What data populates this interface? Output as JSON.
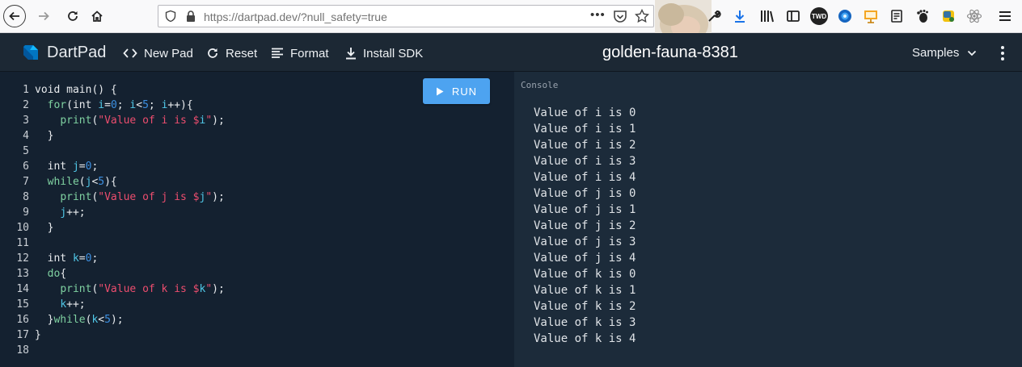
{
  "browser": {
    "url_host": "https://dartpad.dev/",
    "url_path": "?null_safety=true",
    "more_label": "•••",
    "ext_twd_label": "TWD"
  },
  "header": {
    "brand": "DartPad",
    "new_pad": "New Pad",
    "reset": "Reset",
    "format": "Format",
    "install_sdk": "Install SDK",
    "pad_title": "golden-fauna-8381",
    "samples": "Samples"
  },
  "editor": {
    "run_label": "RUN",
    "lines": [
      {
        "n": "1",
        "tokens": [
          {
            "t": "void main() {",
            "c": "plain"
          }
        ]
      },
      {
        "n": "2",
        "tokens": [
          {
            "t": "  ",
            "c": "plain"
          },
          {
            "t": "for",
            "c": "kw"
          },
          {
            "t": "(int ",
            "c": "plain"
          },
          {
            "t": "i",
            "c": "var"
          },
          {
            "t": "=",
            "c": "plain"
          },
          {
            "t": "0",
            "c": "num"
          },
          {
            "t": "; ",
            "c": "plain"
          },
          {
            "t": "i",
            "c": "var"
          },
          {
            "t": "<",
            "c": "plain"
          },
          {
            "t": "5",
            "c": "num"
          },
          {
            "t": "; ",
            "c": "plain"
          },
          {
            "t": "i",
            "c": "var"
          },
          {
            "t": "++){",
            "c": "plain"
          }
        ]
      },
      {
        "n": "3",
        "tokens": [
          {
            "t": "    ",
            "c": "plain"
          },
          {
            "t": "print",
            "c": "fn"
          },
          {
            "t": "(",
            "c": "plain"
          },
          {
            "t": "\"Value of i is $",
            "c": "str"
          },
          {
            "t": "i",
            "c": "var"
          },
          {
            "t": "\"",
            "c": "str"
          },
          {
            "t": ");",
            "c": "plain"
          }
        ]
      },
      {
        "n": "4",
        "tokens": [
          {
            "t": "  }",
            "c": "plain"
          }
        ]
      },
      {
        "n": "5",
        "tokens": []
      },
      {
        "n": "6",
        "tokens": [
          {
            "t": "  int ",
            "c": "plain"
          },
          {
            "t": "j",
            "c": "var"
          },
          {
            "t": "=",
            "c": "plain"
          },
          {
            "t": "0",
            "c": "num"
          },
          {
            "t": ";",
            "c": "plain"
          }
        ]
      },
      {
        "n": "7",
        "tokens": [
          {
            "t": "  ",
            "c": "plain"
          },
          {
            "t": "while",
            "c": "kw"
          },
          {
            "t": "(",
            "c": "plain"
          },
          {
            "t": "j",
            "c": "var"
          },
          {
            "t": "<",
            "c": "plain"
          },
          {
            "t": "5",
            "c": "num"
          },
          {
            "t": "){",
            "c": "plain"
          }
        ]
      },
      {
        "n": "8",
        "tokens": [
          {
            "t": "    ",
            "c": "plain"
          },
          {
            "t": "print",
            "c": "fn"
          },
          {
            "t": "(",
            "c": "plain"
          },
          {
            "t": "\"Value of j is $",
            "c": "str"
          },
          {
            "t": "j",
            "c": "var"
          },
          {
            "t": "\"",
            "c": "str"
          },
          {
            "t": ");",
            "c": "plain"
          }
        ]
      },
      {
        "n": "9",
        "tokens": [
          {
            "t": "    ",
            "c": "plain"
          },
          {
            "t": "j",
            "c": "var"
          },
          {
            "t": "++;",
            "c": "plain"
          }
        ]
      },
      {
        "n": "10",
        "tokens": [
          {
            "t": "  }",
            "c": "plain"
          }
        ]
      },
      {
        "n": "11",
        "tokens": []
      },
      {
        "n": "12",
        "tokens": [
          {
            "t": "  int ",
            "c": "plain"
          },
          {
            "t": "k",
            "c": "var"
          },
          {
            "t": "=",
            "c": "plain"
          },
          {
            "t": "0",
            "c": "num"
          },
          {
            "t": ";",
            "c": "plain"
          }
        ]
      },
      {
        "n": "13",
        "tokens": [
          {
            "t": "  ",
            "c": "plain"
          },
          {
            "t": "do",
            "c": "kw"
          },
          {
            "t": "{",
            "c": "plain"
          }
        ]
      },
      {
        "n": "14",
        "tokens": [
          {
            "t": "    ",
            "c": "plain"
          },
          {
            "t": "print",
            "c": "fn"
          },
          {
            "t": "(",
            "c": "plain"
          },
          {
            "t": "\"Value of k is $",
            "c": "str"
          },
          {
            "t": "k",
            "c": "var"
          },
          {
            "t": "\"",
            "c": "str"
          },
          {
            "t": ");",
            "c": "plain"
          }
        ]
      },
      {
        "n": "15",
        "tokens": [
          {
            "t": "    ",
            "c": "plain"
          },
          {
            "t": "k",
            "c": "var"
          },
          {
            "t": "++;",
            "c": "plain"
          }
        ]
      },
      {
        "n": "16",
        "tokens": [
          {
            "t": "  }",
            "c": "plain"
          },
          {
            "t": "while",
            "c": "kw"
          },
          {
            "t": "(",
            "c": "plain"
          },
          {
            "t": "k",
            "c": "var"
          },
          {
            "t": "<",
            "c": "plain"
          },
          {
            "t": "5",
            "c": "num"
          },
          {
            "t": ");",
            "c": "plain"
          }
        ]
      },
      {
        "n": "17",
        "tokens": [
          {
            "t": "}",
            "c": "plain"
          }
        ]
      },
      {
        "n": "18",
        "tokens": []
      }
    ]
  },
  "console": {
    "title": "Console",
    "output": [
      "Value of i is 0",
      "Value of i is 1",
      "Value of i is 2",
      "Value of i is 3",
      "Value of i is 4",
      "Value of j is 0",
      "Value of j is 1",
      "Value of j is 2",
      "Value of j is 3",
      "Value of j is 4",
      "Value of k is 0",
      "Value of k is 1",
      "Value of k is 2",
      "Value of k is 3",
      "Value of k is 4"
    ]
  },
  "colors": {
    "accent": "#4da3f0",
    "header_bg": "#1c2834",
    "editor_bg": "#142130",
    "console_bg": "#1c2b3a",
    "keyword": "#7fd1a1",
    "number": "#3d8fe0",
    "string": "#ec4d6e",
    "variable": "#50c7e7"
  }
}
